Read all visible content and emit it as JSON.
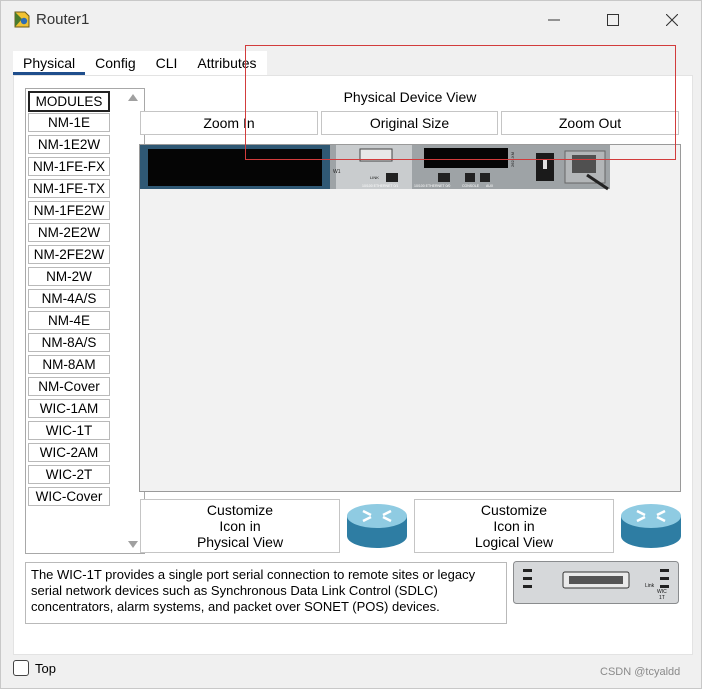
{
  "window": {
    "title": "Router1",
    "minimize_icon": "minimize-icon",
    "maximize_icon": "maximize-icon",
    "close_icon": "close-icon"
  },
  "tabs": [
    {
      "label": "Physical",
      "active": true
    },
    {
      "label": "Config",
      "active": false
    },
    {
      "label": "CLI",
      "active": false
    },
    {
      "label": "Attributes",
      "active": false
    }
  ],
  "modules": {
    "items": [
      "MODULES",
      "NM-1E",
      "NM-1E2W",
      "NM-1FE-FX",
      "NM-1FE-TX",
      "NM-1FE2W",
      "NM-2E2W",
      "NM-2FE2W",
      "NM-2W",
      "NM-4A/S",
      "NM-4E",
      "NM-8A/S",
      "NM-8AM",
      "NM-Cover",
      "WIC-1AM",
      "WIC-1T",
      "WIC-2AM",
      "WIC-2T",
      "WIC-Cover"
    ],
    "selected": "MODULES"
  },
  "physical_view": {
    "title": "Physical Device View",
    "zoom_in": "Zoom In",
    "original_size": "Original Size",
    "zoom_out": "Zoom Out"
  },
  "customize": {
    "physical": {
      "line1": "Customize",
      "line2": "Icon in",
      "line3": "Physical View"
    },
    "logical": {
      "line1": "Customize",
      "line2": "Icon in",
      "line3": "Logical View"
    }
  },
  "description": "The WIC-1T provides a single port serial connection to remote sites or legacy serial network devices such as Synchronous Data Link Control (SDLC) concentrators, alarm systems, and packet over SONET (POS) devices.",
  "module_labels": {
    "wic": "WIC",
    "type": "1T",
    "link": "Link"
  },
  "device_labels": {
    "w1": "W1",
    "link": "LINK",
    "eth0": "10/100 ETHERNET 0/1",
    "eth1": "10/100 ETHERNET 0/0",
    "console": "CONSOLE",
    "aux": "AUX",
    "model": "2621XM"
  },
  "footer": {
    "top_label": "Top",
    "watermark": "CSDN @tcyaldd"
  },
  "colors": {
    "accent": "#1f4e8c",
    "selection_rect": "#d23c3c",
    "router_blue": "#3a8fb0"
  }
}
